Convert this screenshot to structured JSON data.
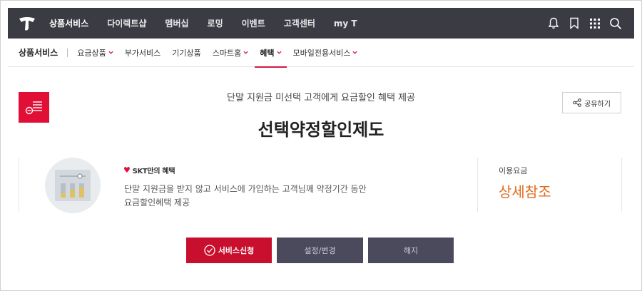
{
  "topnav": {
    "items": [
      "상품서비스",
      "다이렉트샵",
      "멤버십",
      "로밍",
      "이벤트",
      "고객센터",
      "my T"
    ],
    "active_index": 0
  },
  "subnav": {
    "section_title": "상품서비스",
    "items": [
      {
        "label": "요금상품",
        "has_dropdown": true
      },
      {
        "label": "부가서비스",
        "has_dropdown": false
      },
      {
        "label": "기기상품",
        "has_dropdown": false
      },
      {
        "label": "스마트홈",
        "has_dropdown": true
      },
      {
        "label": "혜택",
        "has_dropdown": true
      },
      {
        "label": "모바일전용서비스",
        "has_dropdown": true
      }
    ],
    "active_index": 4
  },
  "header": {
    "subtitle": "단말 지원금 미선택 고객에게 요금할인 혜택 제공",
    "title": "선택약정할인제도",
    "share_label": "공유하기"
  },
  "card": {
    "benefit_tag": "SKT만의 혜택",
    "description_line1": "단말 지원금을 받지 않고 서비스에 가입하는 고객님께 약정기간 동안",
    "description_line2": "요금할인혜택 제공",
    "fee_label": "이용요금",
    "fee_value": "상세참조"
  },
  "buttons": {
    "apply": "서비스신청",
    "settings": "설정/변경",
    "cancel": "해지"
  },
  "colors": {
    "brand_red": "#e10f36",
    "topbar_bg": "#3b3b43",
    "fee_orange": "#e06d1d",
    "button_gray": "#4a4a5c"
  },
  "icons": [
    "t-logo-icon",
    "bell-icon",
    "bookmark-icon",
    "grid-menu-icon",
    "search-icon",
    "share-icon",
    "list-icon",
    "check-circle-icon",
    "heart-icon"
  ]
}
